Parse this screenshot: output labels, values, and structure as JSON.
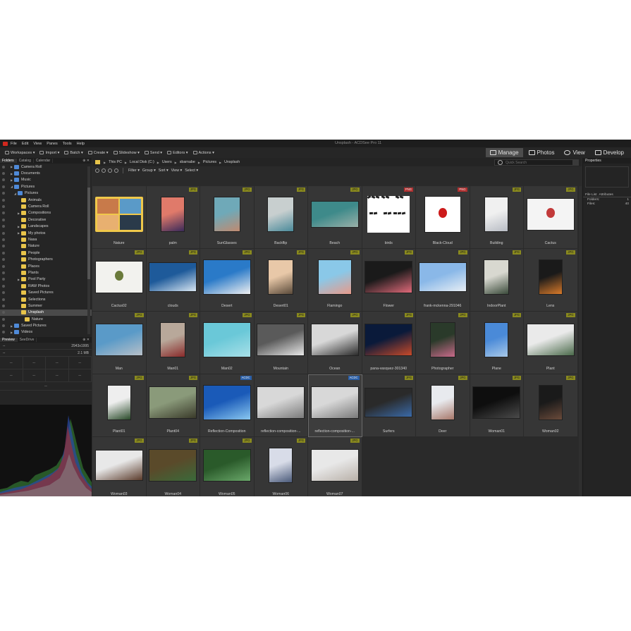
{
  "window": {
    "title": "Unsplash - ACDSee Pro 11"
  },
  "menu": [
    "File",
    "Edit",
    "View",
    "Panes",
    "Tools",
    "Help"
  ],
  "toolbar": [
    "Workspaces",
    "Import",
    "Batch",
    "Create",
    "Slideshow",
    "Send",
    "Editors",
    "Actions"
  ],
  "modes": [
    {
      "label": "Manage",
      "icon": "grid-icon",
      "active": true
    },
    {
      "label": "Photos",
      "icon": "photos-icon",
      "active": false
    },
    {
      "label": "View",
      "icon": "eye-icon",
      "active": false
    },
    {
      "label": "Develop",
      "icon": "develop-icon",
      "active": false
    }
  ],
  "left_tabs": [
    "Folders",
    "Catalog",
    "Calendar"
  ],
  "folders": [
    {
      "label": "Camera Roll",
      "depth": 1,
      "expand": true,
      "blue": true
    },
    {
      "label": "Documents",
      "depth": 1,
      "expand": true,
      "blue": true
    },
    {
      "label": "Music",
      "depth": 1,
      "expand": true,
      "blue": true
    },
    {
      "label": "Pictures",
      "depth": 1,
      "expand": true,
      "open": true,
      "blue": true
    },
    {
      "label": "Pictures",
      "depth": 2,
      "expand": true,
      "open": true,
      "blue": true
    },
    {
      "label": "Animals",
      "depth": 3
    },
    {
      "label": "Camera Roll",
      "depth": 3
    },
    {
      "label": "Compositions",
      "depth": 3,
      "expand": true
    },
    {
      "label": "Decorative",
      "depth": 3
    },
    {
      "label": "Landscapes",
      "depth": 3,
      "expand": true
    },
    {
      "label": "My photos",
      "depth": 3,
      "expand": true
    },
    {
      "label": "Nasa",
      "depth": 3
    },
    {
      "label": "Nature",
      "depth": 3
    },
    {
      "label": "People",
      "depth": 3
    },
    {
      "label": "Photographers",
      "depth": 3
    },
    {
      "label": "Places",
      "depth": 3
    },
    {
      "label": "Plants",
      "depth": 3
    },
    {
      "label": "Pool Party",
      "depth": 3,
      "expand": true
    },
    {
      "label": "RAW Photos",
      "depth": 3
    },
    {
      "label": "Saved Pictures",
      "depth": 3
    },
    {
      "label": "Selections",
      "depth": 3
    },
    {
      "label": "Summer",
      "depth": 3
    },
    {
      "label": "Unsplash",
      "depth": 3,
      "selected": true,
      "open": true
    },
    {
      "label": "Nature",
      "depth": 4
    },
    {
      "label": "Saved Pictures",
      "depth": 1,
      "expand": true,
      "blue": true
    },
    {
      "label": "Videos",
      "depth": 1,
      "expand": true,
      "blue": true
    }
  ],
  "preview_tabs": [
    "Preview",
    "SeeDrive"
  ],
  "preview": {
    "dims_left": "--",
    "dims": "2943x1995",
    "size_left": "--",
    "size": "2.1 MB",
    "dash": "--"
  },
  "path": [
    "This PC",
    "Local Disk (C:)",
    "Users",
    "sbarnabe",
    "Pictures",
    "Unsplash"
  ],
  "search": {
    "placeholder": "Quick Search"
  },
  "filterbar": [
    "Filter",
    "Group",
    "Sort",
    "View",
    "Select"
  ],
  "files": [
    {
      "name": "Nature",
      "badge": "",
      "kind": "folder"
    },
    {
      "name": "palm",
      "badge": "JPG",
      "w": 34,
      "h": 50,
      "c1": "#e07a6a",
      "c2": "#3a2a5a"
    },
    {
      "name": "SunGlasses",
      "badge": "JPG",
      "w": 38,
      "h": 50,
      "c1": "#6fa9b8",
      "c2": "#c08a70"
    },
    {
      "name": "Backflip",
      "badge": "JPG",
      "w": 38,
      "h": 50,
      "c1": "#c8cfcf",
      "c2": "#4a8a9a"
    },
    {
      "name": "Beach",
      "badge": "JPG",
      "w": 68,
      "h": 38,
      "c1": "#3e8a8a",
      "c2": "#9ab0a8"
    },
    {
      "name": "birds",
      "badge": "PNG",
      "w": 60,
      "h": 52,
      "c1": "#ffffff",
      "c2": "#222222",
      "kind": "birds"
    },
    {
      "name": "Black-Cloud",
      "badge": "PNG",
      "w": 52,
      "h": 52,
      "c1": "#ffffff",
      "c2": "#cc1a1a",
      "kind": "dot"
    },
    {
      "name": "Building",
      "badge": "JPG",
      "w": 34,
      "h": 50,
      "c1": "#f0f0f0",
      "c2": "#b8bcc4"
    },
    {
      "name": "Cactus",
      "badge": "JPG",
      "w": 68,
      "h": 46,
      "c1": "#f4f4f4",
      "c2": "#c23a3a",
      "kind": "dot"
    },
    {
      "name": "Cactus02",
      "badge": "JPG",
      "w": 68,
      "h": 46,
      "c1": "#f2f2ee",
      "c2": "#6a7a3a",
      "kind": "dot"
    },
    {
      "name": "clouds",
      "badge": "JPG",
      "w": 68,
      "h": 42,
      "c1": "#1e5a9a",
      "c2": "#d8e6f2"
    },
    {
      "name": "Desert",
      "badge": "JPG",
      "w": 68,
      "h": 50,
      "c1": "#2a7ac8",
      "c2": "#f0f0f0"
    },
    {
      "name": "Desert01",
      "badge": "JPG",
      "w": 36,
      "h": 50,
      "c1": "#e8c8a8",
      "c2": "#5a4a3a"
    },
    {
      "name": "Flamingo",
      "badge": "JPG",
      "w": 48,
      "h": 50,
      "c1": "#8ac8e8",
      "c2": "#e89a8a"
    },
    {
      "name": "Flower",
      "badge": "JPG",
      "w": 68,
      "h": 46,
      "c1": "#1a1a1a",
      "c2": "#e06a7a"
    },
    {
      "name": "frank-mckenna-291046",
      "badge": "JPG",
      "w": 68,
      "h": 42,
      "c1": "#8ab8e8",
      "c2": "#e8eef4"
    },
    {
      "name": "IndoorPlant",
      "badge": "JPG",
      "w": 36,
      "h": 50,
      "c1": "#d8d8d0",
      "c2": "#3a4a3a"
    },
    {
      "name": "Lens",
      "badge": "JPG",
      "w": 34,
      "h": 50,
      "c1": "#1a1a1a",
      "c2": "#d87a2a"
    },
    {
      "name": "Man",
      "badge": "JPG",
      "w": 68,
      "h": 46,
      "c1": "#5a9ac8",
      "c2": "#b8c0c8"
    },
    {
      "name": "Man01",
      "badge": "JPG",
      "w": 36,
      "h": 50,
      "c1": "#b8a89a",
      "c2": "#8a2a2a"
    },
    {
      "name": "Man02",
      "badge": "JPG",
      "w": 68,
      "h": 50,
      "c1": "#6ac8d8",
      "c2": "#a8e0e8"
    },
    {
      "name": "Mountain",
      "badge": "JPG",
      "w": 68,
      "h": 46,
      "c1": "#5a5a5a",
      "c2": "#e8e8e8"
    },
    {
      "name": "Ocean",
      "badge": "JPG",
      "w": 68,
      "h": 46,
      "c1": "#d8d8d8",
      "c2": "#2a2a2a"
    },
    {
      "name": "pana-vasquez-301340",
      "badge": "JPG",
      "w": 68,
      "h": 46,
      "c1": "#0a1a3a",
      "c2": "#c84a2a"
    },
    {
      "name": "Photographer",
      "badge": "JPG",
      "w": 36,
      "h": 50,
      "c1": "#2a3a2a",
      "c2": "#c86a8a"
    },
    {
      "name": "Plane",
      "badge": "JPG",
      "w": 34,
      "h": 50,
      "c1": "#4a8ad8",
      "c2": "#a8c8e8"
    },
    {
      "name": "Plant",
      "badge": "JPG",
      "w": 68,
      "h": 46,
      "c1": "#eaeaea",
      "c2": "#4a6a4a"
    },
    {
      "name": "Plant01",
      "badge": "JPG",
      "w": 34,
      "h": 50,
      "c1": "#eeeeee",
      "c2": "#2a4a2a"
    },
    {
      "name": "Plant04",
      "badge": "JPG",
      "w": 68,
      "h": 46,
      "c1": "#8a9a7a",
      "c2": "#3a3a2a"
    },
    {
      "name": "Reflection-Composition",
      "badge": "ACDC",
      "w": 68,
      "h": 50,
      "c1": "#1a5ab8",
      "c2": "#8ac8f0"
    },
    {
      "name": "reflection-composition-...",
      "badge": "",
      "w": 68,
      "h": 46,
      "c1": "#d8d8d8",
      "c2": "#7a7a7a"
    },
    {
      "name": "reflection-composition-...",
      "badge": "ACDC",
      "w": 68,
      "h": 46,
      "c1": "#d8d8d8",
      "c2": "#7a7a7a",
      "selected": true
    },
    {
      "name": "Surfers",
      "badge": "JPG",
      "w": 68,
      "h": 42,
      "c1": "#2a2a2a",
      "c2": "#3a6aa8"
    },
    {
      "name": "Deer",
      "badge": "JPG",
      "w": 34,
      "h": 50,
      "c1": "#e8eaee",
      "c2": "#a8786a"
    },
    {
      "name": "Woman01",
      "badge": "JPG",
      "w": 68,
      "h": 46,
      "c1": "#0e0e0e",
      "c2": "#4a4a4a"
    },
    {
      "name": "Woman02",
      "badge": "JPG",
      "w": 34,
      "h": 50,
      "c1": "#1a1a1a",
      "c2": "#6a4a3a"
    },
    {
      "name": "Woman03",
      "badge": "JPG",
      "w": 68,
      "h": 44,
      "c1": "#e8e8e8",
      "c2": "#5a3a2a"
    },
    {
      "name": "Woman04",
      "badge": "JPG",
      "w": 68,
      "h": 46,
      "c1": "#5a4a2a",
      "c2": "#3a6a3a"
    },
    {
      "name": "Woman05",
      "badge": "JPG",
      "w": 68,
      "h": 46,
      "c1": "#2a5a2a",
      "c2": "#6aa86a"
    },
    {
      "name": "Woman06",
      "badge": "JPG",
      "w": 34,
      "h": 50,
      "c1": "#d8dce8",
      "c2": "#4a5a7a"
    },
    {
      "name": "Woman07",
      "badge": "JPG",
      "w": 68,
      "h": 46,
      "c1": "#e8e8e8",
      "c2": "#b8b0a8"
    }
  ],
  "properties": {
    "title": "Properties",
    "tabs": [
      "File List",
      "Attributes"
    ],
    "folders_label": "Folders:",
    "folders_val": "1",
    "files_label": "Files:",
    "files_val": "40"
  },
  "colors": {
    "jpg": "#8a8a1e",
    "png": "#b03030",
    "acdc": "#2a5fa8",
    "accent": "#d0281e"
  }
}
